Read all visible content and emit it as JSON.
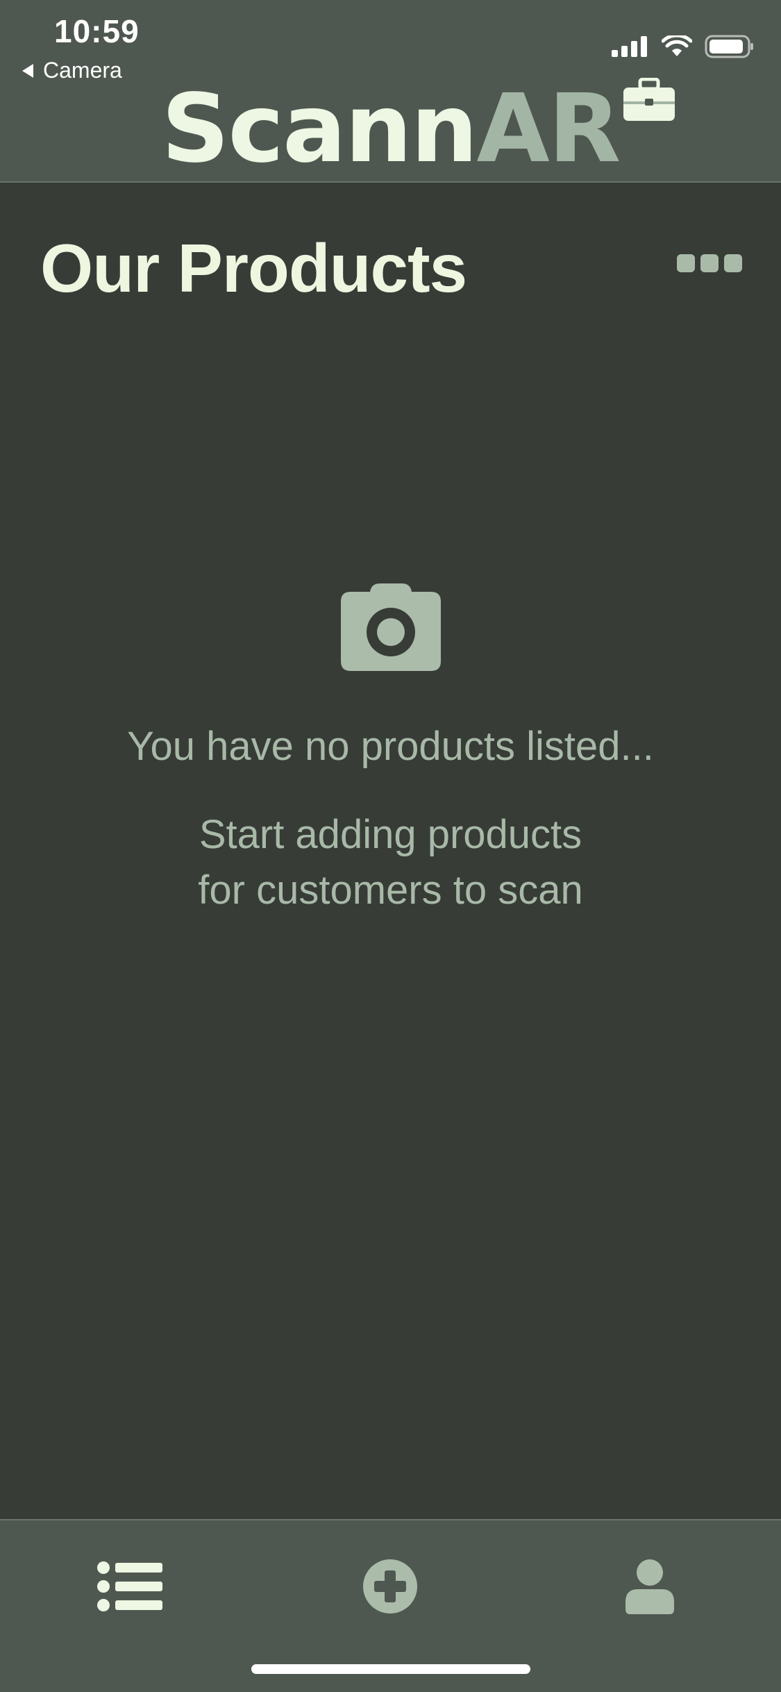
{
  "status_bar": {
    "time": "10:59",
    "back_label": "Camera"
  },
  "header": {
    "logo_part1": "Scann",
    "logo_part2": "AR",
    "logo_icon": "briefcase-icon"
  },
  "page": {
    "title": "Our Products",
    "more_icon": "more-dots-icon"
  },
  "empty_state": {
    "icon": "camera-icon",
    "message": "You have no products listed...",
    "submessage": "Start adding products\nfor customers to scan"
  },
  "tab_bar": {
    "tabs": [
      {
        "icon": "list-icon"
      },
      {
        "icon": "add-circle-icon"
      },
      {
        "icon": "user-icon"
      }
    ]
  },
  "colors": {
    "background": "#373c37",
    "bar": "#4f5850",
    "accent_light": "#eef6e0",
    "accent_muted": "#a9baa9"
  }
}
